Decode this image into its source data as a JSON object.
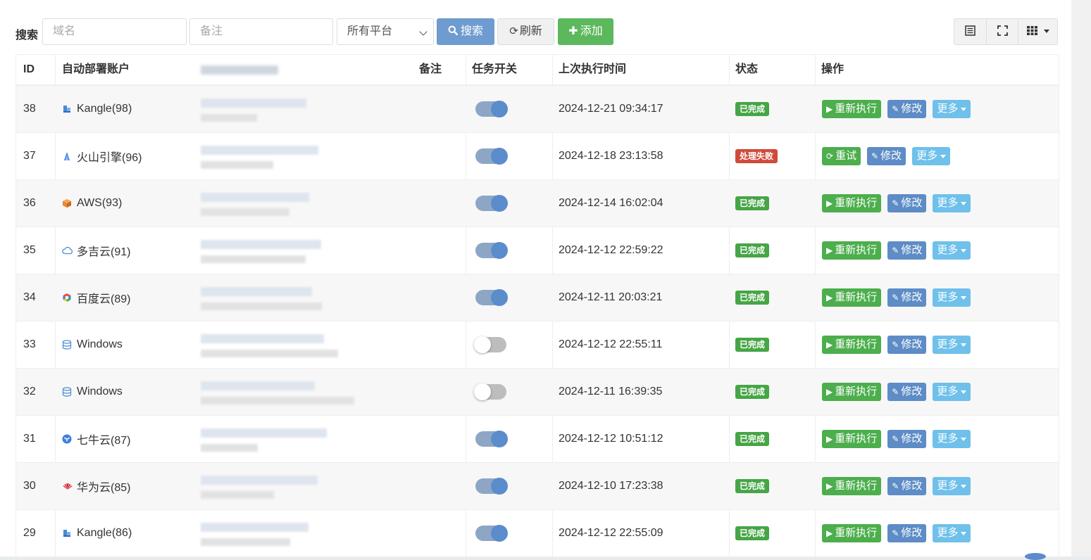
{
  "toolbar": {
    "search_label": "搜索",
    "domain_placeholder": "域名",
    "remark_placeholder": "备注",
    "platform_selected": "所有平台",
    "search_button": "搜索",
    "refresh_button": "刷新",
    "add_button": "添加"
  },
  "colors": {
    "primary": "#6f9cd0",
    "success": "#5cb85c",
    "info": "#6fc0ea",
    "danger": "#d04a3a"
  },
  "table": {
    "headers": {
      "id": "ID",
      "account": "自动部署账户",
      "remark": "备注",
      "task_switch": "任务开关",
      "last_run": "上次执行时间",
      "status": "状态",
      "actions": "操作"
    },
    "rows": [
      {
        "id": "38",
        "account": "Kangle(98)",
        "icon": "kangle-icon",
        "switch": true,
        "last_run": "2024-12-21 09:34:17",
        "status": "已完成",
        "status_type": "ok",
        "action1": "重新执行",
        "action1_icon": "play-circle-icon",
        "action2": "修改",
        "action3": "更多"
      },
      {
        "id": "37",
        "account": "火山引擎(96)",
        "icon": "volcengine-icon",
        "switch": true,
        "last_run": "2024-12-18 23:13:58",
        "status": "处理失败",
        "status_type": "fail",
        "action1": "重试",
        "action1_icon": "refresh-icon",
        "action2": "修改",
        "action3": "更多"
      },
      {
        "id": "36",
        "account": "AWS(93)",
        "icon": "aws-icon",
        "switch": true,
        "last_run": "2024-12-14 16:02:04",
        "status": "已完成",
        "status_type": "ok",
        "action1": "重新执行",
        "action1_icon": "play-circle-icon",
        "action2": "修改",
        "action3": "更多"
      },
      {
        "id": "35",
        "account": "多吉云(91)",
        "icon": "cloud-icon",
        "switch": true,
        "last_run": "2024-12-12 22:59:22",
        "status": "已完成",
        "status_type": "ok",
        "action1": "重新执行",
        "action1_icon": "play-circle-icon",
        "action2": "修改",
        "action3": "更多"
      },
      {
        "id": "34",
        "account": "百度云(89)",
        "icon": "baidu-cloud-icon",
        "switch": true,
        "last_run": "2024-12-11 20:03:21",
        "status": "已完成",
        "status_type": "ok",
        "action1": "重新执行",
        "action1_icon": "play-circle-icon",
        "action2": "修改",
        "action3": "更多"
      },
      {
        "id": "33",
        "account": "Windows",
        "icon": "database-icon",
        "switch": false,
        "last_run": "2024-12-12 22:55:11",
        "status": "已完成",
        "status_type": "ok",
        "action1": "重新执行",
        "action1_icon": "play-circle-icon",
        "action2": "修改",
        "action3": "更多"
      },
      {
        "id": "32",
        "account": "Windows",
        "icon": "database-icon",
        "switch": false,
        "last_run": "2024-12-11 16:39:35",
        "status": "已完成",
        "status_type": "ok",
        "action1": "重新执行",
        "action1_icon": "play-circle-icon",
        "action2": "修改",
        "action3": "更多"
      },
      {
        "id": "31",
        "account": "七牛云(87)",
        "icon": "qiniu-icon",
        "switch": true,
        "last_run": "2024-12-12 10:51:12",
        "status": "已完成",
        "status_type": "ok",
        "action1": "重新执行",
        "action1_icon": "play-circle-icon",
        "action2": "修改",
        "action3": "更多"
      },
      {
        "id": "30",
        "account": "华为云(85)",
        "icon": "huawei-icon",
        "switch": true,
        "last_run": "2024-12-10 17:23:38",
        "status": "已完成",
        "status_type": "ok",
        "action1": "重新执行",
        "action1_icon": "play-circle-icon",
        "action2": "修改",
        "action3": "更多"
      },
      {
        "id": "29",
        "account": "Kangle(86)",
        "icon": "kangle-icon",
        "switch": true,
        "last_run": "2024-12-12 22:55:09",
        "status": "已完成",
        "status_type": "ok",
        "action1": "重新执行",
        "action1_icon": "play-circle-icon",
        "action2": "修改",
        "action3": "更多"
      }
    ]
  }
}
